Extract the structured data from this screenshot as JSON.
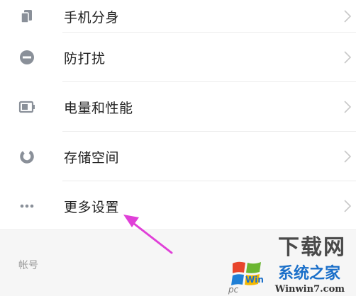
{
  "settings": {
    "items": [
      {
        "label": "手机分身",
        "icon": "phone-clone-icon"
      },
      {
        "label": "防打扰",
        "icon": "do-not-disturb-icon"
      },
      {
        "label": "电量和性能",
        "icon": "battery-icon"
      },
      {
        "label": "存储空间",
        "icon": "storage-icon"
      },
      {
        "label": "更多设置",
        "icon": "more-dots-icon"
      }
    ]
  },
  "section": {
    "title": "帐号"
  },
  "watermark": {
    "top_text": "下载网",
    "middle_text": "系统之家",
    "logo_text": "Win7",
    "bottom_text": "Winwin7.com",
    "side_text": "pc"
  },
  "colors": {
    "icon_gray": "#8a9099",
    "annotation_arrow": "#e040d8",
    "watermark_blue": "#1a6fc9"
  }
}
